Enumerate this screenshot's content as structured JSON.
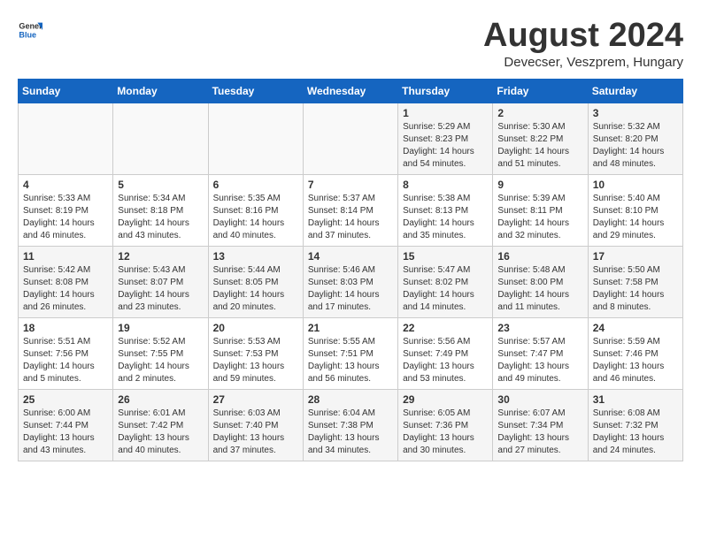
{
  "header": {
    "logo_general": "General",
    "logo_blue": "Blue",
    "month_year": "August 2024",
    "location": "Devecser, Veszprem, Hungary"
  },
  "weekdays": [
    "Sunday",
    "Monday",
    "Tuesday",
    "Wednesday",
    "Thursday",
    "Friday",
    "Saturday"
  ],
  "weeks": [
    [
      {
        "day": "",
        "info": ""
      },
      {
        "day": "",
        "info": ""
      },
      {
        "day": "",
        "info": ""
      },
      {
        "day": "",
        "info": ""
      },
      {
        "day": "1",
        "info": "Sunrise: 5:29 AM\nSunset: 8:23 PM\nDaylight: 14 hours\nand 54 minutes."
      },
      {
        "day": "2",
        "info": "Sunrise: 5:30 AM\nSunset: 8:22 PM\nDaylight: 14 hours\nand 51 minutes."
      },
      {
        "day": "3",
        "info": "Sunrise: 5:32 AM\nSunset: 8:20 PM\nDaylight: 14 hours\nand 48 minutes."
      }
    ],
    [
      {
        "day": "4",
        "info": "Sunrise: 5:33 AM\nSunset: 8:19 PM\nDaylight: 14 hours\nand 46 minutes."
      },
      {
        "day": "5",
        "info": "Sunrise: 5:34 AM\nSunset: 8:18 PM\nDaylight: 14 hours\nand 43 minutes."
      },
      {
        "day": "6",
        "info": "Sunrise: 5:35 AM\nSunset: 8:16 PM\nDaylight: 14 hours\nand 40 minutes."
      },
      {
        "day": "7",
        "info": "Sunrise: 5:37 AM\nSunset: 8:14 PM\nDaylight: 14 hours\nand 37 minutes."
      },
      {
        "day": "8",
        "info": "Sunrise: 5:38 AM\nSunset: 8:13 PM\nDaylight: 14 hours\nand 35 minutes."
      },
      {
        "day": "9",
        "info": "Sunrise: 5:39 AM\nSunset: 8:11 PM\nDaylight: 14 hours\nand 32 minutes."
      },
      {
        "day": "10",
        "info": "Sunrise: 5:40 AM\nSunset: 8:10 PM\nDaylight: 14 hours\nand 29 minutes."
      }
    ],
    [
      {
        "day": "11",
        "info": "Sunrise: 5:42 AM\nSunset: 8:08 PM\nDaylight: 14 hours\nand 26 minutes."
      },
      {
        "day": "12",
        "info": "Sunrise: 5:43 AM\nSunset: 8:07 PM\nDaylight: 14 hours\nand 23 minutes."
      },
      {
        "day": "13",
        "info": "Sunrise: 5:44 AM\nSunset: 8:05 PM\nDaylight: 14 hours\nand 20 minutes."
      },
      {
        "day": "14",
        "info": "Sunrise: 5:46 AM\nSunset: 8:03 PM\nDaylight: 14 hours\nand 17 minutes."
      },
      {
        "day": "15",
        "info": "Sunrise: 5:47 AM\nSunset: 8:02 PM\nDaylight: 14 hours\nand 14 minutes."
      },
      {
        "day": "16",
        "info": "Sunrise: 5:48 AM\nSunset: 8:00 PM\nDaylight: 14 hours\nand 11 minutes."
      },
      {
        "day": "17",
        "info": "Sunrise: 5:50 AM\nSunset: 7:58 PM\nDaylight: 14 hours\nand 8 minutes."
      }
    ],
    [
      {
        "day": "18",
        "info": "Sunrise: 5:51 AM\nSunset: 7:56 PM\nDaylight: 14 hours\nand 5 minutes."
      },
      {
        "day": "19",
        "info": "Sunrise: 5:52 AM\nSunset: 7:55 PM\nDaylight: 14 hours\nand 2 minutes."
      },
      {
        "day": "20",
        "info": "Sunrise: 5:53 AM\nSunset: 7:53 PM\nDaylight: 13 hours\nand 59 minutes."
      },
      {
        "day": "21",
        "info": "Sunrise: 5:55 AM\nSunset: 7:51 PM\nDaylight: 13 hours\nand 56 minutes."
      },
      {
        "day": "22",
        "info": "Sunrise: 5:56 AM\nSunset: 7:49 PM\nDaylight: 13 hours\nand 53 minutes."
      },
      {
        "day": "23",
        "info": "Sunrise: 5:57 AM\nSunset: 7:47 PM\nDaylight: 13 hours\nand 49 minutes."
      },
      {
        "day": "24",
        "info": "Sunrise: 5:59 AM\nSunset: 7:46 PM\nDaylight: 13 hours\nand 46 minutes."
      }
    ],
    [
      {
        "day": "25",
        "info": "Sunrise: 6:00 AM\nSunset: 7:44 PM\nDaylight: 13 hours\nand 43 minutes."
      },
      {
        "day": "26",
        "info": "Sunrise: 6:01 AM\nSunset: 7:42 PM\nDaylight: 13 hours\nand 40 minutes."
      },
      {
        "day": "27",
        "info": "Sunrise: 6:03 AM\nSunset: 7:40 PM\nDaylight: 13 hours\nand 37 minutes."
      },
      {
        "day": "28",
        "info": "Sunrise: 6:04 AM\nSunset: 7:38 PM\nDaylight: 13 hours\nand 34 minutes."
      },
      {
        "day": "29",
        "info": "Sunrise: 6:05 AM\nSunset: 7:36 PM\nDaylight: 13 hours\nand 30 minutes."
      },
      {
        "day": "30",
        "info": "Sunrise: 6:07 AM\nSunset: 7:34 PM\nDaylight: 13 hours\nand 27 minutes."
      },
      {
        "day": "31",
        "info": "Sunrise: 6:08 AM\nSunset: 7:32 PM\nDaylight: 13 hours\nand 24 minutes."
      }
    ]
  ]
}
